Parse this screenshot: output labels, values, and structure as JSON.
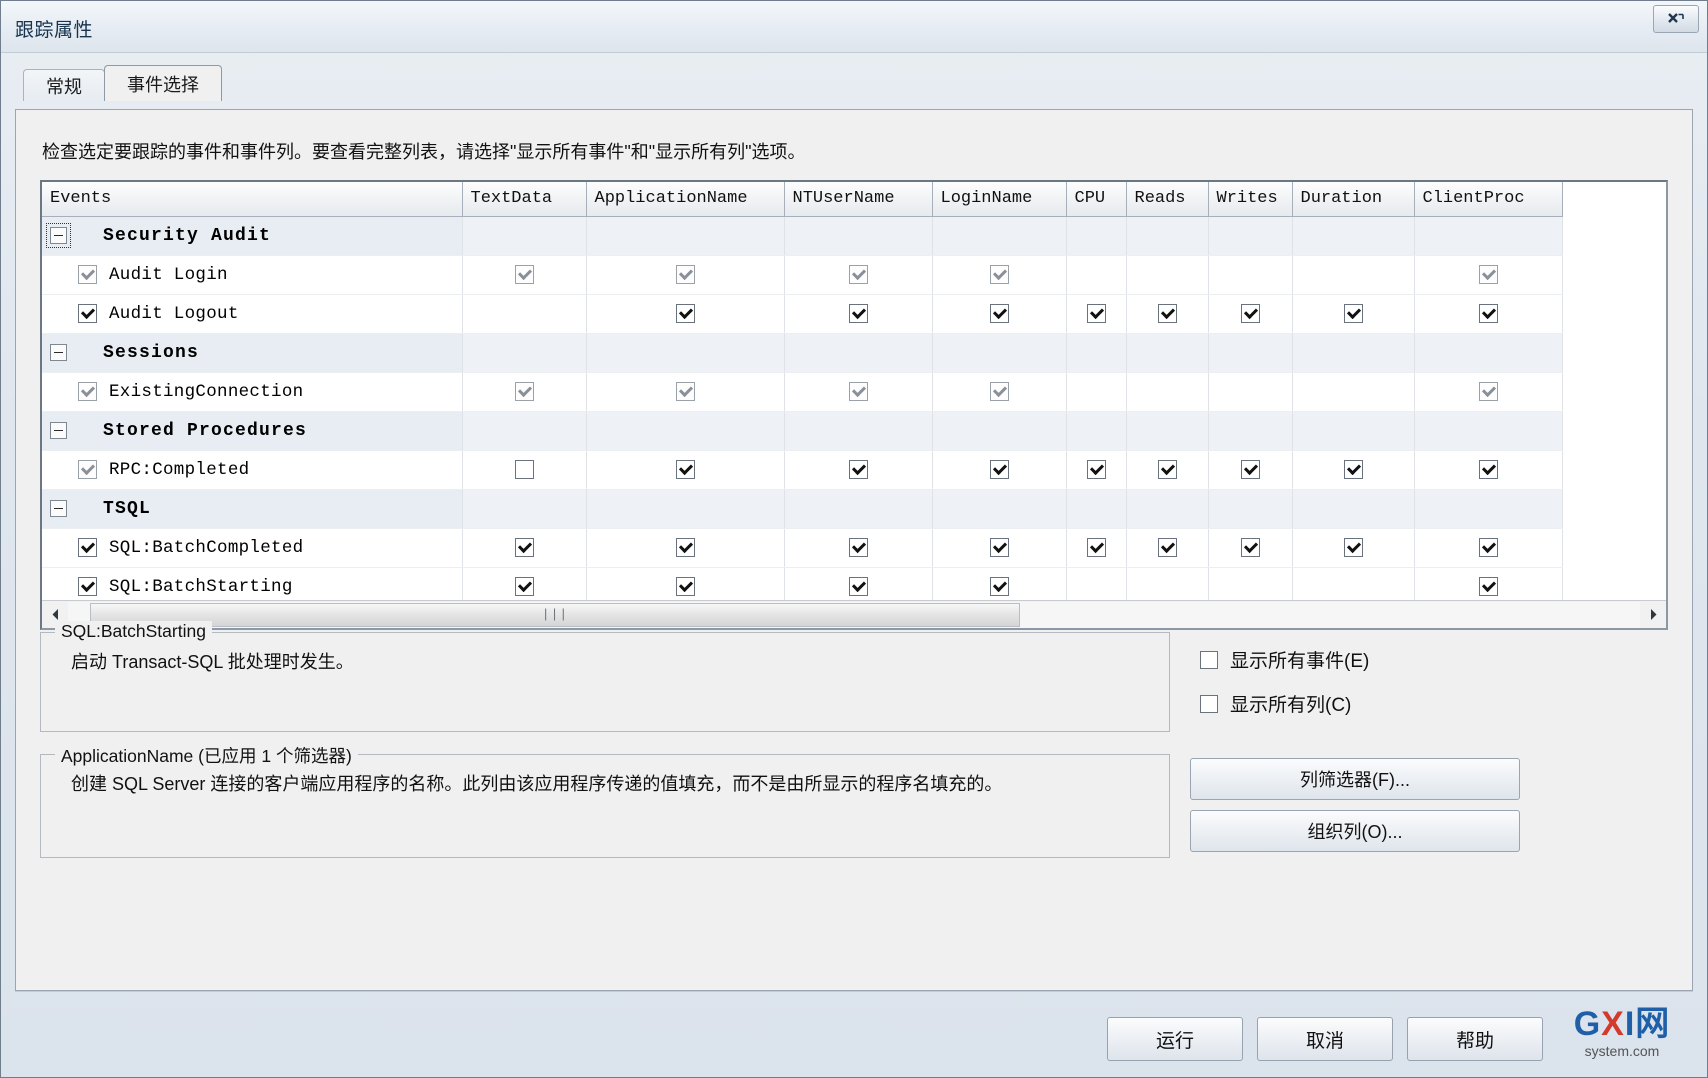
{
  "window": {
    "title": "跟踪属性",
    "close_icon": "close-icon"
  },
  "tabs": [
    {
      "label": "常规",
      "active": false
    },
    {
      "label": "事件选择",
      "active": true
    }
  ],
  "instruction": "检查选定要跟踪的事件和事件列。要查看完整列表，请选择\"显示所有事件\"和\"显示所有列\"选项。",
  "grid": {
    "columns": [
      "Events",
      "TextData",
      "ApplicationName",
      "NTUserName",
      "LoginName",
      "CPU",
      "Reads",
      "Writes",
      "Duration",
      "ClientProc"
    ],
    "rows": [
      {
        "type": "group",
        "label": "Security Audit",
        "expander": "-",
        "focused": true,
        "cells": [
          null,
          null,
          null,
          null,
          null,
          null,
          null,
          null,
          null
        ]
      },
      {
        "type": "event",
        "label": "Audit Login",
        "checked": true,
        "dim": true,
        "cells": [
          "checked-dim",
          "checked-dim",
          "checked-dim",
          "checked-dim",
          null,
          null,
          null,
          null,
          "checked-dim"
        ]
      },
      {
        "type": "event",
        "label": "Audit Logout",
        "checked": true,
        "dim": false,
        "cells": [
          null,
          "checked",
          "checked",
          "checked",
          "checked",
          "checked",
          "checked",
          "checked",
          "checked"
        ]
      },
      {
        "type": "group",
        "label": "Sessions",
        "expander": "-",
        "focused": false,
        "cells": [
          null,
          null,
          null,
          null,
          null,
          null,
          null,
          null,
          null
        ]
      },
      {
        "type": "event",
        "label": "ExistingConnection",
        "checked": true,
        "dim": true,
        "cells": [
          "checked-dim",
          "checked-dim",
          "checked-dim",
          "checked-dim",
          null,
          null,
          null,
          null,
          "checked-dim"
        ]
      },
      {
        "type": "group",
        "label": "Stored Procedures",
        "expander": "-",
        "focused": false,
        "cells": [
          null,
          null,
          null,
          null,
          null,
          null,
          null,
          null,
          null
        ]
      },
      {
        "type": "event",
        "label": "RPC:Completed",
        "checked": true,
        "dim": true,
        "cells": [
          "unchecked",
          "checked",
          "checked",
          "checked",
          "checked",
          "checked",
          "checked",
          "checked",
          "checked"
        ]
      },
      {
        "type": "group",
        "label": "TSQL",
        "expander": "-",
        "focused": false,
        "cells": [
          null,
          null,
          null,
          null,
          null,
          null,
          null,
          null,
          null
        ]
      },
      {
        "type": "event",
        "label": "SQL:BatchCompleted",
        "checked": true,
        "dim": false,
        "cells": [
          "checked",
          "checked",
          "checked",
          "checked",
          "checked",
          "checked",
          "checked",
          "checked",
          "checked"
        ]
      },
      {
        "type": "event",
        "label": "SQL:BatchStarting",
        "checked": true,
        "dim": false,
        "cells": [
          "checked",
          "checked",
          "checked",
          "checked",
          null,
          null,
          null,
          null,
          "checked"
        ]
      }
    ],
    "scrollbar": {
      "left_arrow_icon": "chevron-left-icon",
      "right_arrow_icon": "chevron-right-icon",
      "grip": "|||"
    }
  },
  "event_description": {
    "title": "SQL:BatchStarting",
    "body": "启动 Transact-SQL 批处理时发生。"
  },
  "column_description": {
    "title": "ApplicationName (已应用 1 个筛选器)",
    "body": "创建 SQL Server 连接的客户端应用程序的名称。此列由该应用程序传递的值填充，而不是由所显示的程序名填充的。"
  },
  "options": {
    "show_all_events": {
      "label": "显示所有事件(E)",
      "checked": false
    },
    "show_all_columns": {
      "label": "显示所有列(C)",
      "checked": false
    }
  },
  "side_buttons": {
    "column_filters": "列筛选器(F)...",
    "organize_columns": "组织列(O)..."
  },
  "footer_buttons": {
    "run": "运行",
    "cancel": "取消",
    "help": "帮助"
  },
  "watermark": {
    "main_prefix": "G",
    "main_x": "X",
    "main_suffix": "I网",
    "sub": "system.com"
  }
}
